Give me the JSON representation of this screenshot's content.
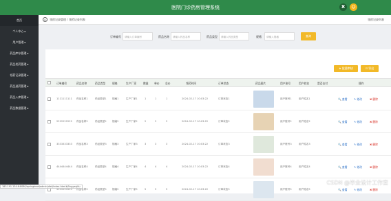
{
  "app_title": "医院门诊药房管理系统",
  "topbar": {
    "icon1": "✖",
    "icon2": "☺",
    "icon1_name": "close-icon",
    "icon2_name": "user-icon"
  },
  "sidebar": {
    "items": [
      {
        "label": "首页"
      },
      {
        "label": "个人中心 ▸"
      },
      {
        "label": "用户管理 ▸"
      },
      {
        "label": "药品库存管理 ▸"
      },
      {
        "label": "药品发药管理 ▸"
      },
      {
        "label": "领药记录管理 ▸"
      },
      {
        "label": "药品退药管理 ▸"
      },
      {
        "label": "药品入库管理 ▸"
      },
      {
        "label": "药品数据管理 ▸"
      }
    ]
  },
  "breadcrumb": {
    "home_icon": "⌂",
    "text": "领药记录管理 / 领药记录列表",
    "right": "领药记录列表"
  },
  "search": {
    "fields": [
      {
        "label": "订单编号",
        "placeholder": "请输入订单编号"
      },
      {
        "label": "药品名称",
        "placeholder": "请输入药品名称"
      },
      {
        "label": "药品类型",
        "placeholder": "请输入药品类型"
      },
      {
        "label": "规格",
        "placeholder": "请输入规格"
      }
    ],
    "button": "查询"
  },
  "actions": {
    "approve": "★ 批量审核",
    "export": "⊡ 导出"
  },
  "table": {
    "headers": [
      "订单编号",
      "药品名称",
      "药品类型",
      "规格",
      "生产厂家",
      "数量",
      "单价",
      "总价",
      "领药时间",
      "订单状态",
      "药品图片",
      "用户账号",
      "用户姓名",
      "是否支付",
      "操作"
    ],
    "rows": [
      {
        "cells": [
          "1111111111",
          "药品名称1",
          "药品类型1",
          "规格1",
          "生产厂家1",
          "1",
          "1",
          "1",
          "2024-02-17 10:03:22",
          "订单状态1",
          "用户账号1",
          "用户姓名1",
          ""
        ]
      },
      {
        "cells": [
          "2222222222",
          "药品名称2",
          "药品类型2",
          "规格2",
          "生产厂家2",
          "2",
          "2",
          "2",
          "2024-02-17 10:03:22",
          "订单状态2",
          "用户账号2",
          "用户姓名2",
          ""
        ]
      },
      {
        "cells": [
          "3333333333",
          "药品名称3",
          "药品类型3",
          "规格3",
          "生产厂家3",
          "3",
          "3",
          "3",
          "2024-02-17 10:03:22",
          "订单状态3",
          "用户账号3",
          "用户姓名3",
          ""
        ]
      },
      {
        "cells": [
          "4444444444",
          "药品名称4",
          "药品类型4",
          "规格4",
          "生产厂家4",
          "4",
          "4",
          "4",
          "2024-02-17 10:03:22",
          "订单状态4",
          "用户账号4",
          "用户姓名4",
          ""
        ]
      },
      {
        "cells": [
          "5555555555",
          "药品名称5",
          "药品类型5",
          "规格5",
          "生产厂家5",
          "5",
          "5",
          "5",
          "2024-02-17 10:03:22",
          "订单状态5",
          "用户账号5",
          "用户姓名5",
          ""
        ]
      }
    ],
    "ops": {
      "view": "🔍 查看",
      "edit": "✎ 修改",
      "del": "✖ 删除"
    }
  },
  "img_colors": [
    "#c9d9ea",
    "#e7d3b4",
    "#dfe8dc",
    "#f1ddd0",
    "#dce6ef"
  ],
  "watermark": "CSDN @毕业设计工作室",
  "statusbar": "183.191.134.6:8080/springboot/admin/dist/index.html#/lingyaojilu"
}
